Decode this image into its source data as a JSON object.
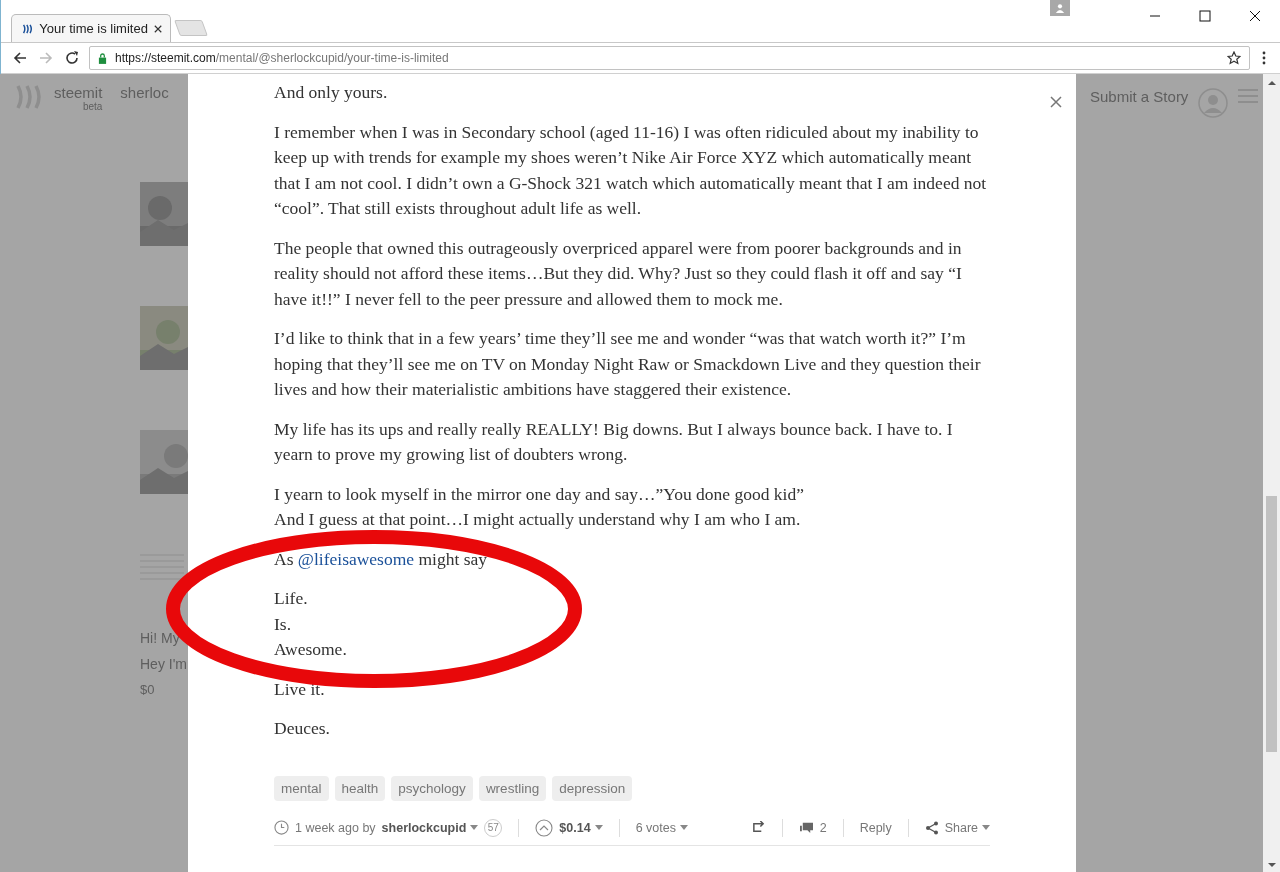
{
  "browser": {
    "tab_title": "Your time is limited",
    "url_host": "https://steemit.com",
    "url_path": "/mental/@sherlockcupid/your-time-is-limited"
  },
  "background": {
    "logo_text": "steemit",
    "logo_sub": "beta",
    "nav_text": "sherloc",
    "submit_label": "Submit a Story",
    "card_title": "Hi! My",
    "card_text": "Hey I'm",
    "card_payout": "$0"
  },
  "post": {
    "paragraphs": [
      {
        "kind": "text",
        "lines": [
          "And only yours."
        ]
      },
      {
        "kind": "text",
        "lines": [
          "I remember when I was in Secondary school (aged 11-16) I was often ridiculed about my inability to keep up with trends for example my shoes weren’t Nike Air Force XYZ which automatically meant that I am not cool. I didn’t own a G-Shock 321 watch which automatically meant that I am indeed not “cool”. That still exists throughout adult life as well."
        ]
      },
      {
        "kind": "text",
        "lines": [
          "The people that owned this outrageously overpriced apparel were from poorer backgrounds and in reality should not afford these items…But they did. Why? Just so they could flash it off and say “I have it!!” I never fell to the peer pressure and allowed them to mock me."
        ]
      },
      {
        "kind": "text",
        "lines": [
          "I’d like to think that in a few years’ time they’ll see me and wonder “was that watch worth it?” I’m hoping that they’ll see me on TV on Monday Night Raw or Smackdown Live and they question their lives and how their materialistic ambitions have staggered their existence."
        ]
      },
      {
        "kind": "text",
        "lines": [
          "My life has its ups and really really REALLY! Big downs. But I always bounce back. I have to. I yearn to prove my growing list of doubters wrong."
        ]
      },
      {
        "kind": "text",
        "lines": [
          "I yearn to look myself in the mirror one day and say…”You done good kid”",
          "And I guess at that point…I might actually understand why I am who I am."
        ]
      },
      {
        "kind": "mention",
        "before": "As ",
        "link": "@lifeisawesome",
        "after": " might say"
      },
      {
        "kind": "text",
        "lines": [
          "Life.",
          "Is.",
          "Awesome."
        ]
      },
      {
        "kind": "text",
        "lines": [
          "Live it."
        ]
      },
      {
        "kind": "text",
        "lines": [
          "Deuces."
        ]
      }
    ],
    "tags": [
      "mental",
      "health",
      "psychology",
      "wrestling",
      "depression"
    ],
    "footer": {
      "time": "1 week ago by",
      "author": "sherlockcupid",
      "reputation": "57",
      "payout": "$0.14",
      "votes": "6 votes",
      "comments": "2",
      "reply": "Reply",
      "share": "Share"
    }
  }
}
